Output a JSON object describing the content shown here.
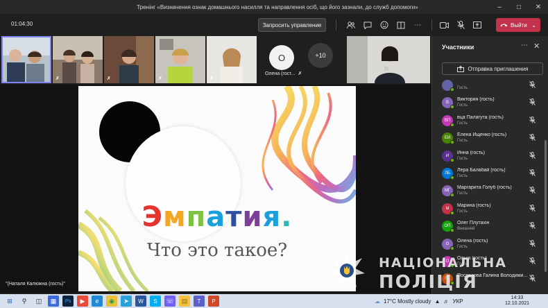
{
  "window": {
    "title": "Тренінг «Визначення ознак домашнього насилля та направлення осіб, що його зазнали, до служб допомоги»",
    "minimize_icon": "minimize-icon",
    "maximize_icon": "maximize-icon",
    "close_icon": "close-icon"
  },
  "toolbar": {
    "timer": "01:04:30",
    "request_control_label": "Запросить управление",
    "leave_label": "Выйти"
  },
  "tiles": {
    "avatar_initial": "О",
    "avatar_name": "Олена (гост...",
    "overflow_count": "+10"
  },
  "stage": {
    "slide_word_letters": [
      "Э",
      "м",
      "п",
      "а",
      "т",
      "и",
      "я",
      "."
    ],
    "slide_subtitle": "Что это такое?",
    "presenter_label": "\"(Наталя Калюжна (гость)\""
  },
  "watermark": {
    "line1": "НАЦІОНАЛЬНА",
    "line2": "ПОЛІЦІЯ"
  },
  "panel": {
    "title": "Участники",
    "invite_label": "Отправка приглашения",
    "participants": [
      {
        "initials": "",
        "name": "",
        "role": "Гость",
        "color": "#6264a7"
      },
      {
        "initials": "В",
        "name": "Виктория (гость)",
        "role": "Гость",
        "color": "#8764b8"
      },
      {
        "initials": "ВП",
        "name": "вца Палагута (гость)",
        "role": "Гость",
        "color": "#c239b3"
      },
      {
        "initials": "ЕИ",
        "name": "Елена Ищенко (гость)",
        "role": "Гость",
        "color": "#498205"
      },
      {
        "initials": "И",
        "name": "Инна (гость)",
        "role": "Гость",
        "color": "#5c2e91"
      },
      {
        "initials": "ЛБ",
        "name": "Лера Балабай (гость)",
        "role": "Гость",
        "color": "#0078d4"
      },
      {
        "initials": "МГ",
        "name": "Маргарита Голуб (гость)",
        "role": "Гость",
        "color": "#8764b8"
      },
      {
        "initials": "М",
        "name": "Марина (гость)",
        "role": "Гость",
        "color": "#c4314b"
      },
      {
        "initials": "ОП",
        "name": "Олег Плутахін",
        "role": "Внешний",
        "color": "#13a10e"
      },
      {
        "initials": "О",
        "name": "Олена (гость)",
        "role": "Гость",
        "color": "#8764b8"
      },
      {
        "initials": "О",
        "name": "Ольга (гость)",
        "role": "Гость",
        "color": "#c239b3"
      },
      {
        "initials": "ПГ",
        "name": "Поспелова Галина Володими...",
        "role": "",
        "color": "#ca5010"
      }
    ]
  },
  "taskbar": {
    "weather": "17°C  Mostly cloudy",
    "language": "УКР",
    "time": "14:33",
    "date": "12.10.2021"
  },
  "colors": {
    "accent": "#7f85f5",
    "leave": "#c4314b"
  }
}
